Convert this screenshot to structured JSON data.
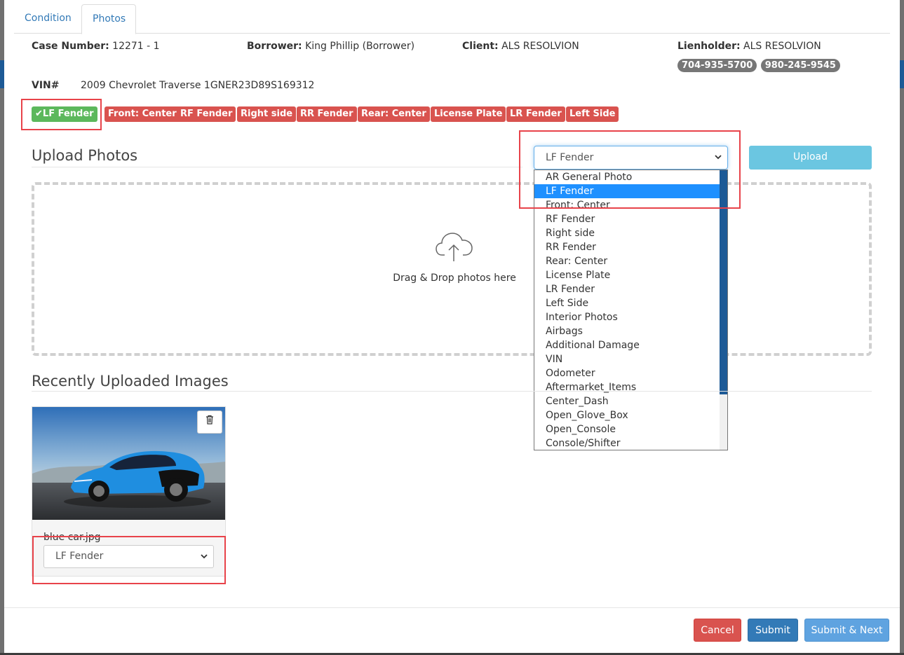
{
  "tabs": [
    {
      "label": "Condition"
    },
    {
      "label": "Photos"
    }
  ],
  "case": {
    "case_number_label": "Case Number:",
    "case_number": "12271 - 1",
    "borrower_label": "Borrower:",
    "borrower": "King Phillip (Borrower)",
    "client_label": "Client:",
    "client": "ALS RESOLVION",
    "lienholder_label": "Lienholder:",
    "lienholder": "ALS RESOLVION",
    "phones": [
      "704-935-5700",
      "980-245-9545"
    ],
    "vin_label": "VIN#",
    "vin_value": "2009 Chevrolet Traverse 1GNER23D89S169312"
  },
  "photo_badges": [
    {
      "label": "LF Fender",
      "status": "done"
    },
    {
      "label": "Front: Center",
      "status": "missing"
    },
    {
      "label": "RF Fender",
      "status": "missing"
    },
    {
      "label": "Right side",
      "status": "missing"
    },
    {
      "label": "RR Fender",
      "status": "missing"
    },
    {
      "label": "Rear: Center",
      "status": "missing"
    },
    {
      "label": "License Plate",
      "status": "missing"
    },
    {
      "label": "LR Fender",
      "status": "missing"
    },
    {
      "label": "Left Side",
      "status": "missing"
    }
  ],
  "upload": {
    "title": "Upload Photos",
    "selected_type": "LF Fender",
    "upload_button": "Upload",
    "dropzone_text": "Drag & Drop photos here"
  },
  "dropdown": {
    "selected_index": 1,
    "options": [
      "AR General Photo",
      "LF Fender",
      "Front: Center",
      "RF Fender",
      "Right side",
      "RR Fender",
      "Rear: Center",
      "License Plate",
      "LR Fender",
      "Left Side",
      "Interior Photos",
      "Airbags",
      "Additional Damage",
      "VIN",
      "Odometer",
      "Aftermarket_Items",
      "Center_Dash",
      "Open_Glove_Box",
      "Open_Console",
      "Console/Shifter"
    ]
  },
  "recent": {
    "title": "Recently Uploaded Images",
    "images": [
      {
        "filename": "blue car.jpg",
        "photo_type": "LF Fender"
      }
    ]
  },
  "footer": {
    "cancel": "Cancel",
    "submit": "Submit",
    "submit_next": "Submit & Next"
  },
  "colors": {
    "danger": "#d9534f",
    "success": "#5cb85c",
    "primary": "#337ab7",
    "info": "#5bc0de",
    "highlight": "#e8434a"
  },
  "icons": {
    "check": "check-icon",
    "chevron": "chevron-down-icon",
    "cloud": "cloud-upload-icon",
    "trash": "trash-icon"
  }
}
